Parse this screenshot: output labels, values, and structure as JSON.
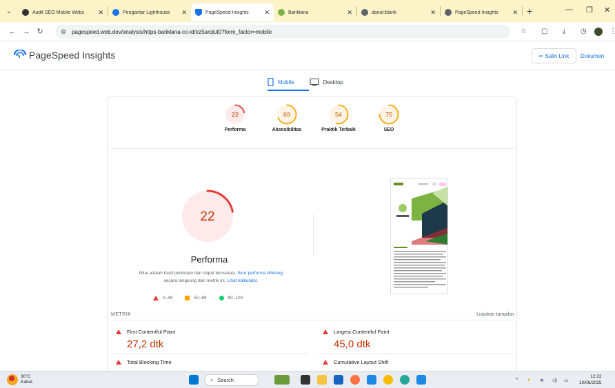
{
  "browser": {
    "tabs": [
      {
        "title": "Audit SEO Mobile Webs",
        "favicon_color": "#333333",
        "active": false
      },
      {
        "title": "Pengantar Lighthouse",
        "favicon_color": "#1a73e8",
        "active": false
      },
      {
        "title": "PageSpeed Insights",
        "favicon_color": "#1a73e8",
        "active": true
      },
      {
        "title": "Banklana",
        "favicon_color": "#7cb342",
        "active": false
      },
      {
        "title": "about:blank",
        "favicon_color": "#5f6368",
        "active": false
      },
      {
        "title": "PageSpeed Insights",
        "favicon_color": "#5f6368",
        "active": false
      }
    ],
    "url": "pagespeed.web.dev/analysis/https-bariklana-co-id/ez5arqlut0?form_factor=mobile"
  },
  "psi": {
    "brand": "PageSpeed Insights",
    "copy_link": "Salin Link",
    "docs": "Dokumen",
    "device_tabs": [
      {
        "label": "Mobile",
        "active": true
      },
      {
        "label": "Desktop",
        "active": false
      }
    ]
  },
  "scores": [
    {
      "label": "Performa",
      "value": 22,
      "color": "#e53935",
      "bg": "#fdeaea"
    },
    {
      "label": "Aksesibilitas",
      "value": 69,
      "color": "#ffa400",
      "bg": "#fff4e5"
    },
    {
      "label": "Praktik Terbaik",
      "value": 54,
      "color": "#ffa400",
      "bg": "#fff4e5"
    },
    {
      "label": "SEO",
      "value": 75,
      "color": "#ffa400",
      "bg": "#fff4e5"
    }
  ],
  "performance": {
    "score": "22",
    "label": "Performa",
    "note_pre": "Nilai adalah hasil perkiraan dan dapat bervariasi.",
    "note_link1": "Skor performa dihitung",
    "note_mid": "secara langsung dari metrik ini.",
    "note_link2": "Lihat kalkulator.",
    "legend": [
      "0–49",
      "50–89",
      "90–100"
    ]
  },
  "metrics_section": {
    "heading": "METRIK",
    "expand": "Luaskan tampilan",
    "items": [
      {
        "title": "First Contentful Paint",
        "value": "27,2 dtk"
      },
      {
        "title": "Largest Contentful Paint",
        "value": "45,0 dtk"
      },
      {
        "title": "Total Blocking Time",
        "value": ""
      },
      {
        "title": "Cumulative Layout Shift",
        "value": ""
      }
    ]
  },
  "taskbar": {
    "temp": "30°C",
    "weather": "Kabut",
    "search": "Search",
    "time": "12:22",
    "date": "10/06/2025"
  }
}
